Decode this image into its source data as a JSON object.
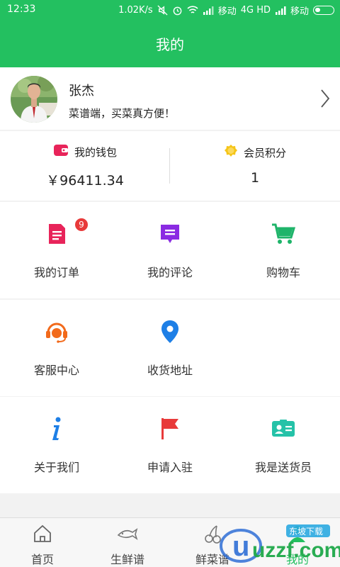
{
  "status_bar": {
    "time": "12:33",
    "net_speed": "1.02K/s",
    "carrier1": "移动",
    "network": "4G HD",
    "carrier2": "移动"
  },
  "header": {
    "title": "我的"
  },
  "profile": {
    "name": "张杰",
    "slogan": "菜谱端，买菜真方便！"
  },
  "wallet": {
    "wallet_label": "我的钱包",
    "wallet_value": "￥96411.34",
    "points_label": "会员积分",
    "points_value": "1"
  },
  "menu": {
    "orders": {
      "label": "我的订单",
      "badge": "9",
      "color": "#e8245a"
    },
    "comments": {
      "label": "我的评论",
      "color": "#8a2be2"
    },
    "cart": {
      "label": "购物车",
      "color": "#1fb46a"
    },
    "service": {
      "label": "客服中心",
      "color": "#f26a1b"
    },
    "address": {
      "label": "收货地址",
      "color": "#1e7fe6"
    },
    "about": {
      "label": "关于我们",
      "color": "#1e7fe6"
    },
    "join": {
      "label": "申请入驻",
      "color": "#e83a3a"
    },
    "courier": {
      "label": "我是送货员",
      "color": "#25c2a8"
    }
  },
  "tabbar": {
    "home": "首页",
    "fresh": "生鲜谱",
    "recipes": "鲜菜谱",
    "mine": "我的"
  },
  "watermark": {
    "text": "uzzf.com",
    "sub": "东坡下载"
  },
  "colors": {
    "brand_green": "#23c060",
    "divider": "#dddddd"
  }
}
